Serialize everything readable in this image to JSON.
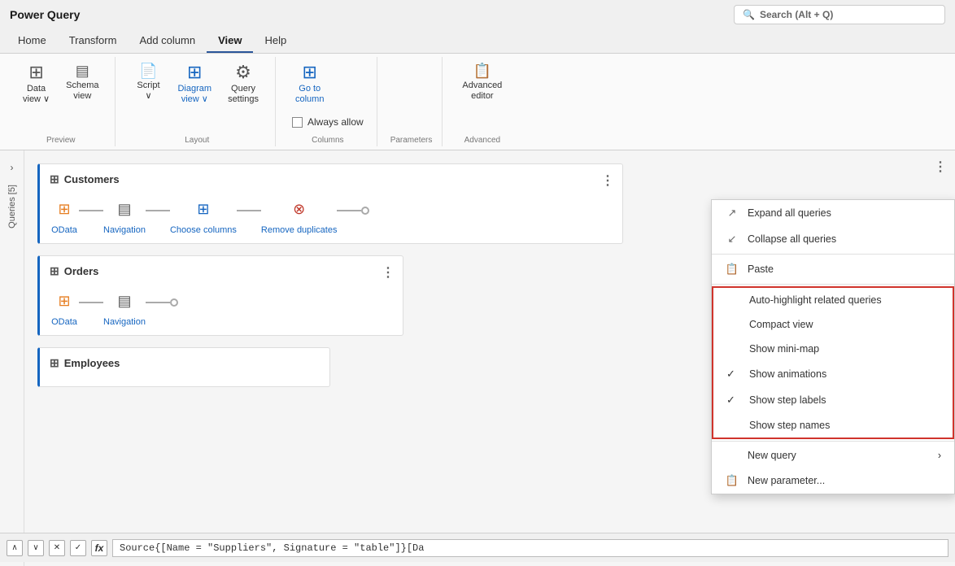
{
  "title": "Power Query",
  "search": {
    "placeholder": "Search (Alt + Q)"
  },
  "menu": {
    "items": [
      "Home",
      "Transform",
      "Add column",
      "View",
      "Help"
    ],
    "active": "View"
  },
  "ribbon": {
    "groups": [
      {
        "label": "Preview",
        "items": [
          {
            "id": "data-view",
            "icon": "⊞",
            "label": "Data\nview ∨",
            "blue": false
          },
          {
            "id": "schema-view",
            "icon": "⊟",
            "label": "Schema\nview",
            "blue": false
          }
        ]
      },
      {
        "label": "Layout",
        "items": [
          {
            "id": "script-view",
            "icon": "📄",
            "label": "Script\n∨",
            "blue": false
          },
          {
            "id": "diagram-view",
            "icon": "⊞",
            "label": "Diagram\nview ∨",
            "blue": true
          },
          {
            "id": "query-settings",
            "icon": "⚙",
            "label": "Query\nsettings",
            "blue": false
          }
        ]
      },
      {
        "label": "Columns",
        "items": [
          {
            "id": "go-to-column",
            "icon": "⊞",
            "label": "Go to\ncolumn",
            "blue": true
          }
        ],
        "checkbox": {
          "label": "Always allow",
          "checked": false
        }
      },
      {
        "label": "Parameters",
        "items": []
      },
      {
        "label": "Advanced",
        "items": [
          {
            "id": "advanced-editor",
            "icon": "📋",
            "label": "Advanced\neditor",
            "blue": false
          }
        ]
      }
    ]
  },
  "sidebar": {
    "toggle_label": "Queries [5]"
  },
  "queries": [
    {
      "id": "customers",
      "name": "Customers",
      "steps": [
        {
          "id": "odata",
          "label": "OData",
          "icon_type": "odata"
        },
        {
          "id": "navigation",
          "label": "Navigation",
          "icon_type": "nav"
        },
        {
          "id": "choose-columns",
          "label": "Choose columns",
          "icon_type": "choosecol"
        },
        {
          "id": "remove-duplicates",
          "label": "Remove duplicates",
          "icon_type": "removedup"
        }
      ]
    },
    {
      "id": "orders",
      "name": "Orders",
      "steps": [
        {
          "id": "odata",
          "label": "OData",
          "icon_type": "odata"
        },
        {
          "id": "navigation",
          "label": "Navigation",
          "icon_type": "nav"
        }
      ]
    },
    {
      "id": "employees",
      "name": "Employees",
      "steps": []
    }
  ],
  "context_menu": {
    "items": [
      {
        "id": "expand-all",
        "label": "Expand all queries",
        "icon": "↗",
        "check": "",
        "has_submenu": false,
        "highlighted": false
      },
      {
        "id": "collapse-all",
        "label": "Collapse all queries",
        "icon": "↙",
        "check": "",
        "has_submenu": false,
        "highlighted": false
      },
      {
        "id": "paste",
        "label": "Paste",
        "icon": "📋",
        "check": "",
        "has_submenu": false,
        "highlighted": false,
        "divider_after": true
      },
      {
        "id": "auto-highlight",
        "label": "Auto-highlight related queries",
        "icon": "",
        "check": "",
        "has_submenu": false,
        "highlighted": true
      },
      {
        "id": "compact-view",
        "label": "Compact view",
        "icon": "",
        "check": "",
        "has_submenu": false,
        "highlighted": true
      },
      {
        "id": "show-mini-map",
        "label": "Show mini-map",
        "icon": "",
        "check": "",
        "has_submenu": false,
        "highlighted": true
      },
      {
        "id": "show-animations",
        "label": "Show animations",
        "icon": "",
        "check": "✓",
        "has_submenu": false,
        "highlighted": true
      },
      {
        "id": "show-step-labels",
        "label": "Show step labels",
        "icon": "",
        "check": "✓",
        "has_submenu": false,
        "highlighted": true
      },
      {
        "id": "show-step-names",
        "label": "Show step names",
        "icon": "",
        "check": "",
        "has_submenu": false,
        "highlighted": true,
        "divider_after": true
      },
      {
        "id": "new-query",
        "label": "New query",
        "icon": "",
        "check": "",
        "has_submenu": true,
        "highlighted": false
      },
      {
        "id": "new-parameter",
        "label": "New parameter...",
        "icon": "📋",
        "check": "",
        "has_submenu": false,
        "highlighted": false
      }
    ]
  },
  "bottom_bar": {
    "formula": "Source{[Name = \"Suppliers\", Signature = \"table\"]}[Da"
  }
}
